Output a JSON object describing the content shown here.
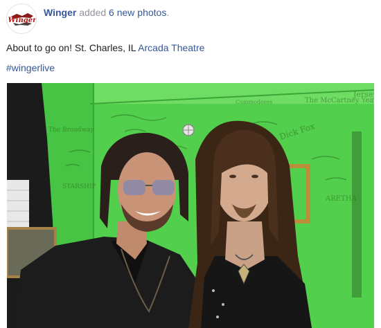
{
  "post": {
    "page_name": "Winger",
    "action_text": "added",
    "action_link": "6 new photos",
    "action_end": ".",
    "avatar_logo": "Winger",
    "text_prefix": "About to go on! St. Charles, IL ",
    "venue_link": "Arcada Theatre",
    "hashtag": "#wingerlive"
  },
  "photo": {
    "wall_writing": [
      "The McCartney Years",
      "Jersey Guys",
      "STARSHIP",
      "ARETHA",
      "Commodores",
      "Dick Fox",
      "The Broadway"
    ]
  },
  "colors": {
    "link": "#365899",
    "muted": "#90949c",
    "wall_green": "#4fcf4a"
  }
}
